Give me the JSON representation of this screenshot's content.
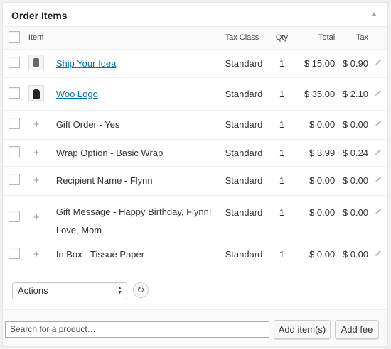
{
  "panel": {
    "title": "Order Items"
  },
  "columns": {
    "item": "Item",
    "tax_class": "Tax Class",
    "qty": "Qty",
    "total": "Total",
    "tax": "Tax"
  },
  "rows": [
    {
      "type": "product",
      "thumb": "shirt-thumbnail",
      "name": "Ship Your Idea",
      "tax_class": "Standard",
      "qty": "1",
      "total": "$ 15.00",
      "tax": "$ 0.90"
    },
    {
      "type": "product",
      "thumb": "hoodie-thumbnail",
      "name": "Woo Logo",
      "tax_class": "Standard",
      "qty": "1",
      "total": "$ 35.00",
      "tax": "$ 2.10"
    },
    {
      "type": "option",
      "name": "Gift Order - Yes",
      "tax_class": "Standard",
      "qty": "1",
      "total": "$ 0.00",
      "tax": "$ 0.00"
    },
    {
      "type": "option",
      "name": "Wrap Option - Basic Wrap",
      "tax_class": "Standard",
      "qty": "1",
      "total": "$ 3.99",
      "tax": "$ 0.24"
    },
    {
      "type": "option",
      "name": "Recipient Name - Flynn",
      "tax_class": "Standard",
      "qty": "1",
      "total": "$ 0.00",
      "tax": "$ 0.00"
    },
    {
      "type": "option",
      "name": "Gift Message - Happy Birthday, Flynn!",
      "name_line2": "Love, Mom",
      "tax_class": "Standard",
      "qty": "1",
      "total": "$ 0.00",
      "tax": "$ 0.00"
    },
    {
      "type": "option",
      "name": "In Box - Tissue Paper",
      "tax_class": "Standard",
      "qty": "1",
      "total": "$ 0.00",
      "tax": "$ 0.00"
    }
  ],
  "plus_glyph": "+",
  "actions": {
    "select_value": "Actions",
    "refresh_icon": "refresh-icon"
  },
  "search": {
    "placeholder": "Search for a product…"
  },
  "buttons": {
    "add_items": "Add item(s)",
    "add_fee": "Add fee"
  },
  "colors": {
    "link": "#0073aa",
    "border": "#e5e5e5"
  }
}
